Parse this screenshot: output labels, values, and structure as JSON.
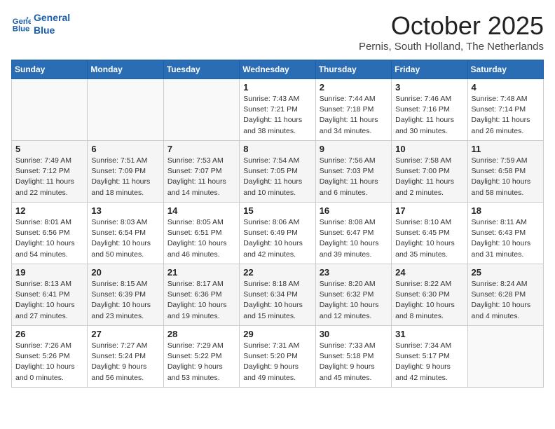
{
  "header": {
    "logo_line1": "General",
    "logo_line2": "Blue",
    "title": "October 2025",
    "subtitle": "Pernis, South Holland, The Netherlands"
  },
  "weekdays": [
    "Sunday",
    "Monday",
    "Tuesday",
    "Wednesday",
    "Thursday",
    "Friday",
    "Saturday"
  ],
  "weeks": [
    [
      {
        "day": "",
        "info": ""
      },
      {
        "day": "",
        "info": ""
      },
      {
        "day": "",
        "info": ""
      },
      {
        "day": "1",
        "info": "Sunrise: 7:43 AM\nSunset: 7:21 PM\nDaylight: 11 hours\nand 38 minutes."
      },
      {
        "day": "2",
        "info": "Sunrise: 7:44 AM\nSunset: 7:18 PM\nDaylight: 11 hours\nand 34 minutes."
      },
      {
        "day": "3",
        "info": "Sunrise: 7:46 AM\nSunset: 7:16 PM\nDaylight: 11 hours\nand 30 minutes."
      },
      {
        "day": "4",
        "info": "Sunrise: 7:48 AM\nSunset: 7:14 PM\nDaylight: 11 hours\nand 26 minutes."
      }
    ],
    [
      {
        "day": "5",
        "info": "Sunrise: 7:49 AM\nSunset: 7:12 PM\nDaylight: 11 hours\nand 22 minutes."
      },
      {
        "day": "6",
        "info": "Sunrise: 7:51 AM\nSunset: 7:09 PM\nDaylight: 11 hours\nand 18 minutes."
      },
      {
        "day": "7",
        "info": "Sunrise: 7:53 AM\nSunset: 7:07 PM\nDaylight: 11 hours\nand 14 minutes."
      },
      {
        "day": "8",
        "info": "Sunrise: 7:54 AM\nSunset: 7:05 PM\nDaylight: 11 hours\nand 10 minutes."
      },
      {
        "day": "9",
        "info": "Sunrise: 7:56 AM\nSunset: 7:03 PM\nDaylight: 11 hours\nand 6 minutes."
      },
      {
        "day": "10",
        "info": "Sunrise: 7:58 AM\nSunset: 7:00 PM\nDaylight: 11 hours\nand 2 minutes."
      },
      {
        "day": "11",
        "info": "Sunrise: 7:59 AM\nSunset: 6:58 PM\nDaylight: 10 hours\nand 58 minutes."
      }
    ],
    [
      {
        "day": "12",
        "info": "Sunrise: 8:01 AM\nSunset: 6:56 PM\nDaylight: 10 hours\nand 54 minutes."
      },
      {
        "day": "13",
        "info": "Sunrise: 8:03 AM\nSunset: 6:54 PM\nDaylight: 10 hours\nand 50 minutes."
      },
      {
        "day": "14",
        "info": "Sunrise: 8:05 AM\nSunset: 6:51 PM\nDaylight: 10 hours\nand 46 minutes."
      },
      {
        "day": "15",
        "info": "Sunrise: 8:06 AM\nSunset: 6:49 PM\nDaylight: 10 hours\nand 42 minutes."
      },
      {
        "day": "16",
        "info": "Sunrise: 8:08 AM\nSunset: 6:47 PM\nDaylight: 10 hours\nand 39 minutes."
      },
      {
        "day": "17",
        "info": "Sunrise: 8:10 AM\nSunset: 6:45 PM\nDaylight: 10 hours\nand 35 minutes."
      },
      {
        "day": "18",
        "info": "Sunrise: 8:11 AM\nSunset: 6:43 PM\nDaylight: 10 hours\nand 31 minutes."
      }
    ],
    [
      {
        "day": "19",
        "info": "Sunrise: 8:13 AM\nSunset: 6:41 PM\nDaylight: 10 hours\nand 27 minutes."
      },
      {
        "day": "20",
        "info": "Sunrise: 8:15 AM\nSunset: 6:39 PM\nDaylight: 10 hours\nand 23 minutes."
      },
      {
        "day": "21",
        "info": "Sunrise: 8:17 AM\nSunset: 6:36 PM\nDaylight: 10 hours\nand 19 minutes."
      },
      {
        "day": "22",
        "info": "Sunrise: 8:18 AM\nSunset: 6:34 PM\nDaylight: 10 hours\nand 15 minutes."
      },
      {
        "day": "23",
        "info": "Sunrise: 8:20 AM\nSunset: 6:32 PM\nDaylight: 10 hours\nand 12 minutes."
      },
      {
        "day": "24",
        "info": "Sunrise: 8:22 AM\nSunset: 6:30 PM\nDaylight: 10 hours\nand 8 minutes."
      },
      {
        "day": "25",
        "info": "Sunrise: 8:24 AM\nSunset: 6:28 PM\nDaylight: 10 hours\nand 4 minutes."
      }
    ],
    [
      {
        "day": "26",
        "info": "Sunrise: 7:26 AM\nSunset: 5:26 PM\nDaylight: 10 hours\nand 0 minutes."
      },
      {
        "day": "27",
        "info": "Sunrise: 7:27 AM\nSunset: 5:24 PM\nDaylight: 9 hours\nand 56 minutes."
      },
      {
        "day": "28",
        "info": "Sunrise: 7:29 AM\nSunset: 5:22 PM\nDaylight: 9 hours\nand 53 minutes."
      },
      {
        "day": "29",
        "info": "Sunrise: 7:31 AM\nSunset: 5:20 PM\nDaylight: 9 hours\nand 49 minutes."
      },
      {
        "day": "30",
        "info": "Sunrise: 7:33 AM\nSunset: 5:18 PM\nDaylight: 9 hours\nand 45 minutes."
      },
      {
        "day": "31",
        "info": "Sunrise: 7:34 AM\nSunset: 5:17 PM\nDaylight: 9 hours\nand 42 minutes."
      },
      {
        "day": "",
        "info": ""
      }
    ]
  ]
}
